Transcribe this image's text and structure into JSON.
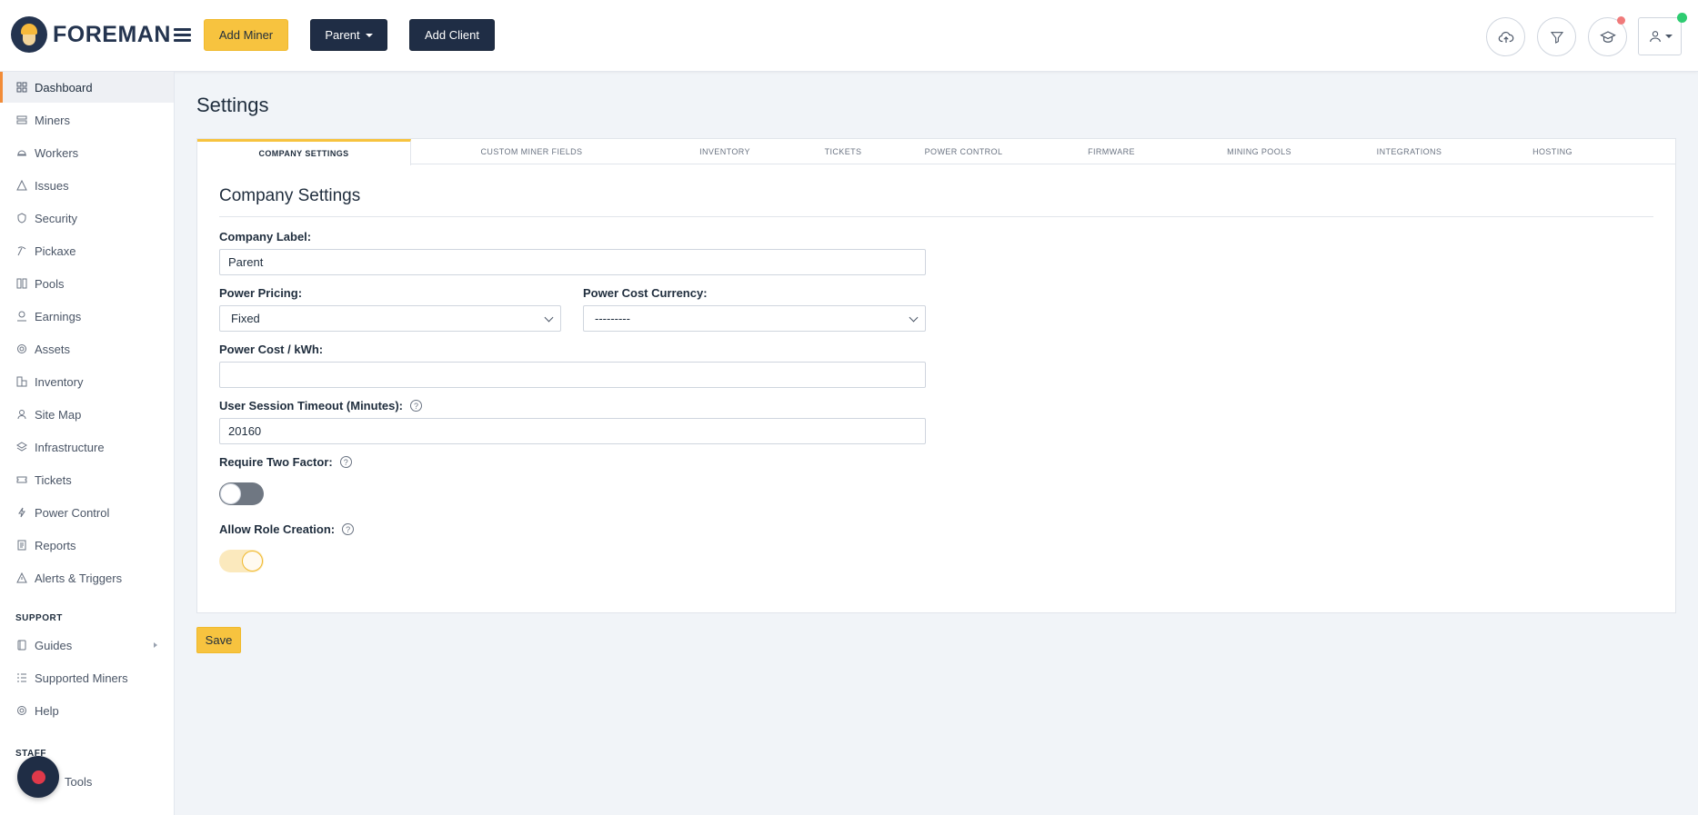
{
  "brand": {
    "name": "FOREMAN"
  },
  "header": {
    "add_miner": "Add Miner",
    "parent_dropdown": "Parent",
    "add_client": "Add Client",
    "icons": [
      "cloud-upload-icon",
      "filter-icon",
      "graduation-cap-icon",
      "user-icon"
    ],
    "notification_color": "#f07a7a",
    "status_color": "#2ecc71"
  },
  "sidebar": {
    "items": [
      {
        "label": "Dashboard",
        "icon": "dashboard-icon",
        "active": true
      },
      {
        "label": "Miners",
        "icon": "miners-icon"
      },
      {
        "label": "Workers",
        "icon": "workers-icon"
      },
      {
        "label": "Issues",
        "icon": "warning-icon"
      },
      {
        "label": "Security",
        "icon": "shield-icon"
      },
      {
        "label": "Pickaxe",
        "icon": "pickaxe-icon"
      },
      {
        "label": "Pools",
        "icon": "pools-icon"
      },
      {
        "label": "Earnings",
        "icon": "earnings-icon"
      },
      {
        "label": "Assets",
        "icon": "assets-icon"
      },
      {
        "label": "Inventory",
        "icon": "inventory-icon"
      },
      {
        "label": "Site Map",
        "icon": "site-map-icon"
      },
      {
        "label": "Infrastructure",
        "icon": "layers-icon"
      },
      {
        "label": "Tickets",
        "icon": "ticket-icon"
      },
      {
        "label": "Power Control",
        "icon": "bolt-icon"
      },
      {
        "label": "Reports",
        "icon": "report-icon"
      },
      {
        "label": "Alerts & Triggers",
        "icon": "alert-icon"
      }
    ],
    "support_label": "SUPPORT",
    "support_items": [
      {
        "label": "Guides",
        "icon": "book-icon"
      },
      {
        "label": "Supported Miners",
        "icon": "list-icon"
      },
      {
        "label": "Help",
        "icon": "lifebuoy-icon"
      }
    ],
    "staff_label": "STAFF",
    "staff_items": [
      {
        "label": "Tools",
        "icon": "tools-icon"
      }
    ]
  },
  "page": {
    "title": "Settings"
  },
  "tabs": [
    {
      "label": "COMPANY SETTINGS",
      "active": true
    },
    {
      "label": "CUSTOM MINER FIELDS"
    },
    {
      "label": "INVENTORY"
    },
    {
      "label": "TICKETS"
    },
    {
      "label": "POWER CONTROL"
    },
    {
      "label": "FIRMWARE"
    },
    {
      "label": "MINING POOLS"
    },
    {
      "label": "INTEGRATIONS"
    },
    {
      "label": "HOSTING"
    }
  ],
  "form": {
    "section_title": "Company Settings",
    "company_label": {
      "label": "Company Label:",
      "value": "Parent"
    },
    "power_pricing": {
      "label": "Power Pricing:",
      "value": "Fixed"
    },
    "power_cost_currency": {
      "label": "Power Cost Currency:",
      "value": "---------"
    },
    "power_cost_kwh": {
      "label": "Power Cost / kWh:",
      "value": ""
    },
    "session_timeout": {
      "label": "User Session Timeout (Minutes):",
      "value": "20160"
    },
    "require_two_factor": {
      "label": "Require Two Factor:",
      "enabled": false
    },
    "allow_role_creation": {
      "label": "Allow Role Creation:",
      "enabled": true
    },
    "help_glyph": "?",
    "save_label": "Save"
  }
}
